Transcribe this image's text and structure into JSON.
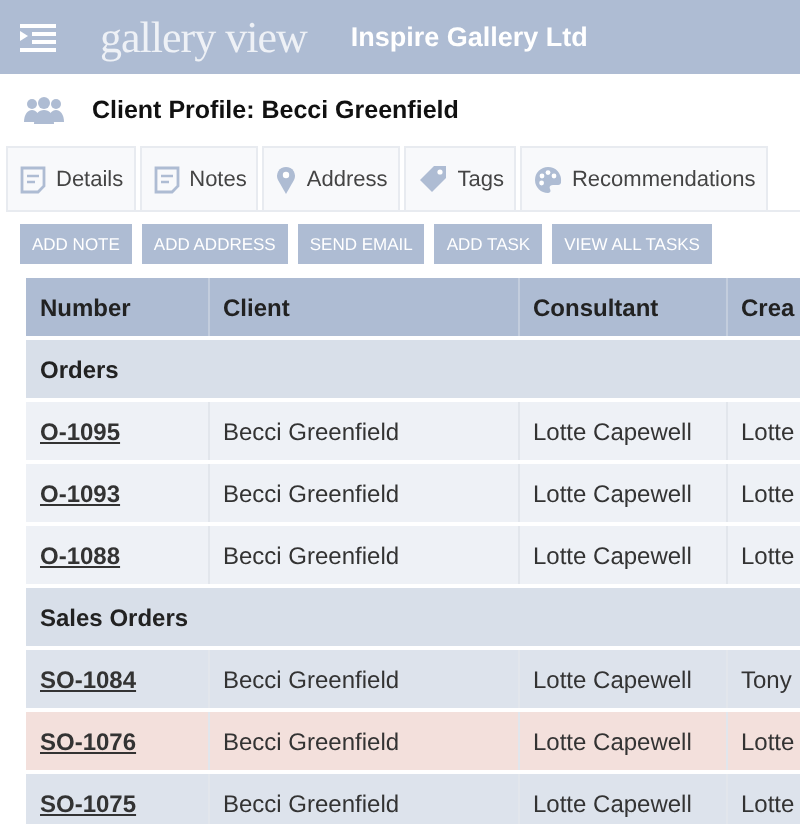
{
  "header": {
    "logo": "gallery view",
    "company": "Inspire Gallery Ltd"
  },
  "page_title": "Client Profile: Becci Greenfield",
  "tabs": [
    {
      "label": "Details",
      "kind": "note",
      "selected": false
    },
    {
      "label": "Notes",
      "kind": "note",
      "selected": false
    },
    {
      "label": "Address",
      "kind": "pin",
      "selected": false
    },
    {
      "label": "Tags",
      "kind": "tag",
      "selected": false
    },
    {
      "label": "Recommendations",
      "kind": "palette",
      "selected": false
    }
  ],
  "actions": [
    "ADD NOTE",
    "ADD ADDRESS",
    "SEND EMAIL",
    "ADD TASK",
    "VIEW ALL TASKS"
  ],
  "table": {
    "columns": [
      "Number",
      "Client",
      "Consultant",
      "Crea"
    ],
    "groups": [
      {
        "title": "Orders",
        "rows": [
          {
            "number": "O-1095",
            "client": "Becci Greenfield",
            "consultant": "Lotte Capewell",
            "column_4": "Lotte",
            "color": "#eef1f6"
          },
          {
            "number": "O-1093",
            "client": "Becci Greenfield",
            "consultant": "Lotte Capewell",
            "column_4": "Lotte",
            "color": "#eef1f6"
          },
          {
            "number": "O-1088",
            "client": "Becci Greenfield",
            "consultant": "Lotte Capewell",
            "column_4": "Lotte",
            "color": "#eef1f6"
          }
        ]
      },
      {
        "title": "Sales Orders",
        "rows": [
          {
            "number": "SO-1084",
            "client": "Becci Greenfield",
            "consultant": "Lotte Capewell",
            "column_4": "Tony",
            "color": "#dde3ec"
          },
          {
            "number": "SO-1076",
            "client": "Becci Greenfield",
            "consultant": "Lotte Capewell",
            "column_4": "Lotte",
            "color": "#f3e0dc"
          },
          {
            "number": "SO-1075",
            "client": "Becci Greenfield",
            "consultant": "Lotte Capewell",
            "column_4": "Lotte",
            "color": "#dde3ec"
          }
        ]
      }
    ]
  }
}
